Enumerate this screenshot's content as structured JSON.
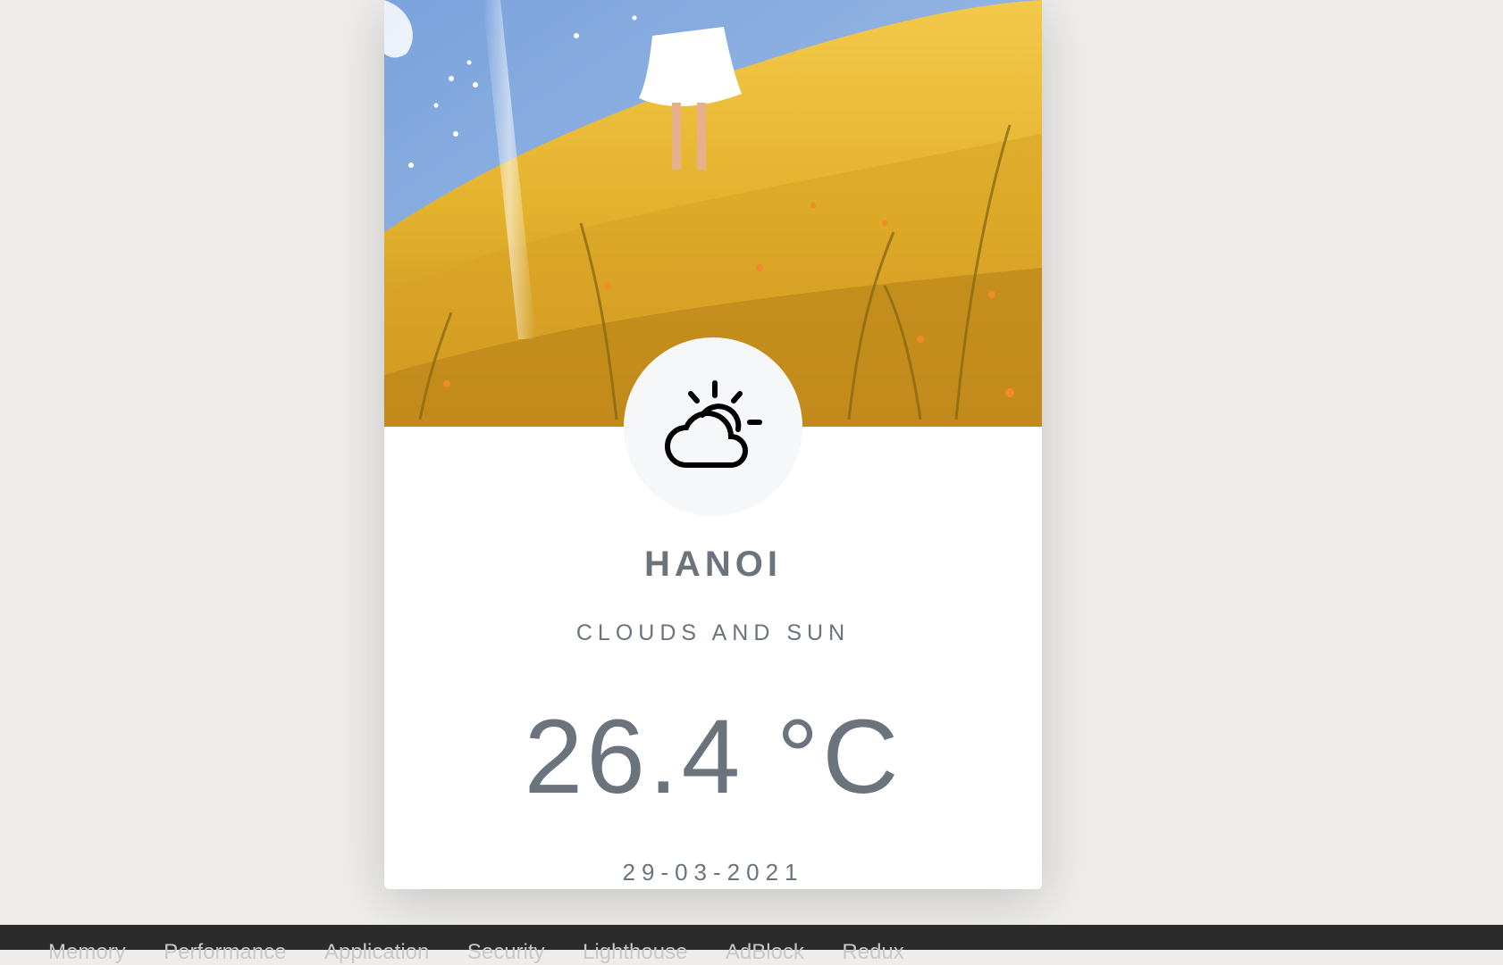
{
  "weather": {
    "city": "HANOI",
    "description": "CLOUDS AND SUN",
    "temperature": "26.4 °C",
    "date": "29-03-2021",
    "icon": "cloud-sun-icon"
  },
  "devtools": {
    "tabs": [
      "Memory",
      "Performance",
      "Application",
      "Security",
      "Lighthouse",
      "AdBlock",
      "Redux"
    ]
  },
  "colors": {
    "page_background": "#eeedeb",
    "card_background": "#ffffff",
    "text": "#6b737c",
    "icon_circle": "#f6f7f9",
    "devtools_bar": "#2b2b2b"
  }
}
